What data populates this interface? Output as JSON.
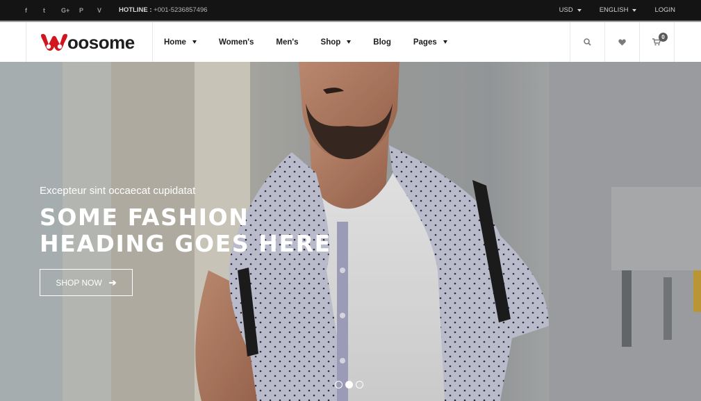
{
  "topbar": {
    "social": [
      {
        "icon": "facebook-icon",
        "glyph": "f"
      },
      {
        "icon": "twitter-icon",
        "glyph": "t"
      },
      {
        "icon": "google-plus-icon",
        "glyph": "G+"
      },
      {
        "icon": "pinterest-icon",
        "glyph": "P"
      },
      {
        "icon": "vimeo-icon",
        "glyph": "V"
      }
    ],
    "hotline_label": "HOTLINE :",
    "hotline_number": "+001-5236857496",
    "currency": "USD",
    "language": "ENGLISH",
    "login": "LOGIN"
  },
  "header": {
    "logo_text": "oosome",
    "nav": [
      {
        "label": "Home",
        "dropdown": true
      },
      {
        "label": "Women's",
        "dropdown": false
      },
      {
        "label": "Men's",
        "dropdown": false
      },
      {
        "label": "Shop",
        "dropdown": true
      },
      {
        "label": "Blog",
        "dropdown": false
      },
      {
        "label": "Pages",
        "dropdown": true
      }
    ],
    "cart_count": "0",
    "brand_color": "#d0171f"
  },
  "hero": {
    "subtitle": "Excepteur sint occaecat cupidatat",
    "heading": "Some fashion heading goes here",
    "button_label": "SHOP NOW",
    "slides": 3,
    "active_slide": 2
  }
}
